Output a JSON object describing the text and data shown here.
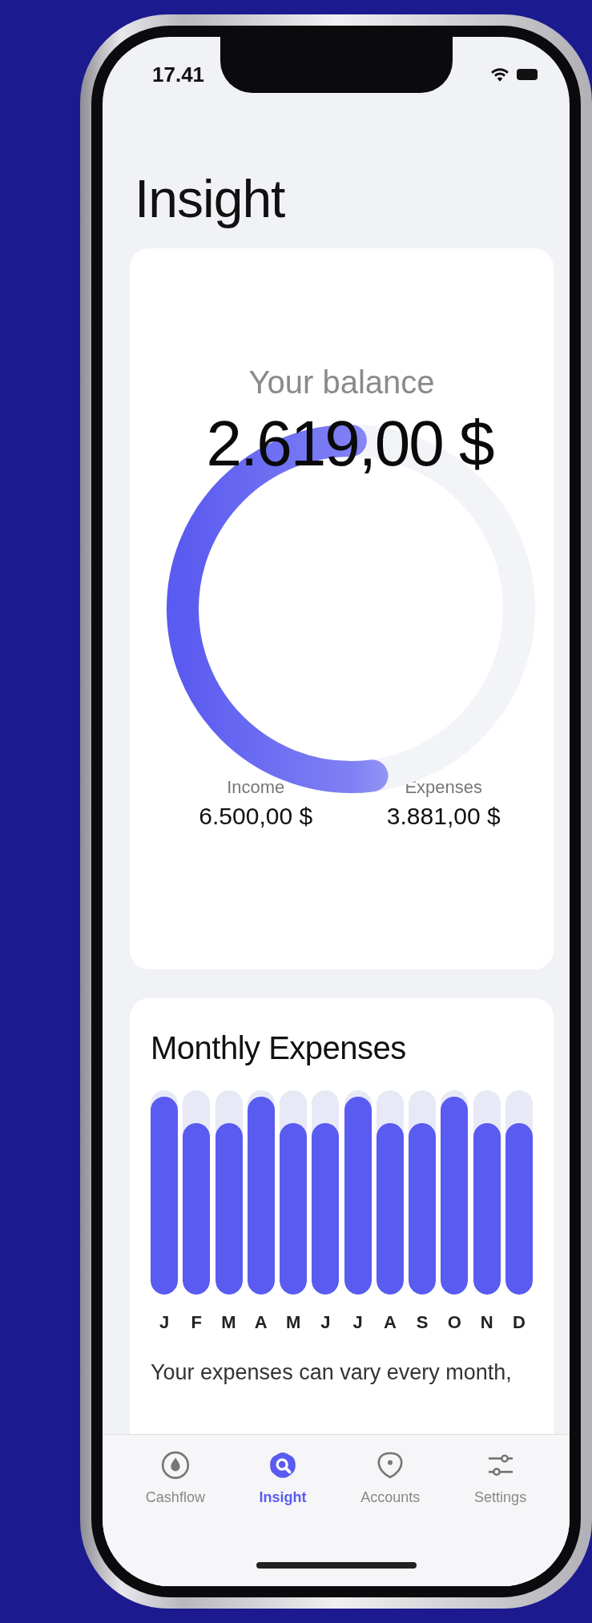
{
  "status_bar": {
    "time": "17.41"
  },
  "title": "Insight",
  "balance_card": {
    "label": "Your balance",
    "amount": "2.619,00 $",
    "level": 0.52,
    "stats": [
      {
        "label": "Income",
        "value": "6.500,00 $"
      },
      {
        "label": "Expenses",
        "value": "3.881,00 $"
      }
    ]
  },
  "expenses_card": {
    "title": "Monthly Expenses",
    "months": [
      {
        "label": "J",
        "level": 0.97
      },
      {
        "label": "F",
        "level": 0.84
      },
      {
        "label": "M",
        "level": 0.84
      },
      {
        "label": "A",
        "level": 0.97
      },
      {
        "label": "M",
        "level": 0.84
      },
      {
        "label": "J",
        "level": 0.84
      },
      {
        "label": "J",
        "level": 0.97
      },
      {
        "label": "A",
        "level": 0.84
      },
      {
        "label": "S",
        "level": 0.84
      },
      {
        "label": "O",
        "level": 0.97
      },
      {
        "label": "N",
        "level": 0.84
      },
      {
        "label": "D",
        "level": 0.84
      }
    ],
    "note": "Your expenses can vary every month,"
  },
  "tab_bar": [
    {
      "label": "Cashflow",
      "kind": "drop",
      "selected": false
    },
    {
      "label": "Insight",
      "kind": "search",
      "selected": true
    },
    {
      "label": "Accounts",
      "kind": "pin",
      "selected": false
    },
    {
      "label": "Settings",
      "kind": "sliders",
      "selected": false
    }
  ]
}
